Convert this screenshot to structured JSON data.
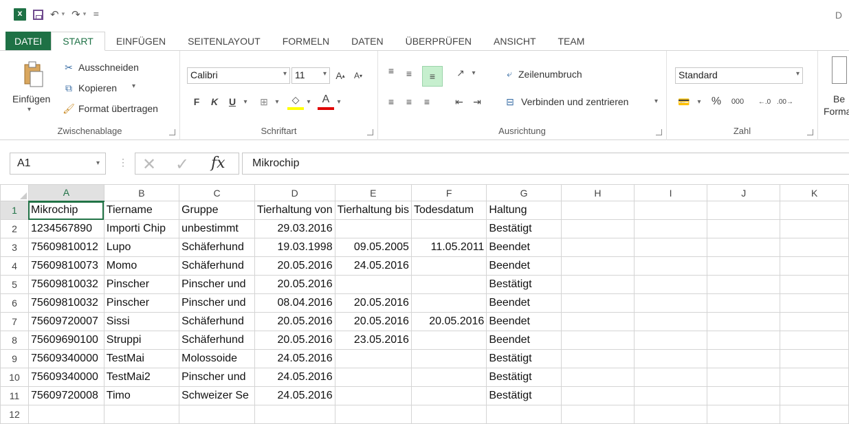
{
  "app": {
    "logo_text": "X",
    "title_partial": "D"
  },
  "tabs": [
    {
      "label": "DATEI"
    },
    {
      "label": "START"
    },
    {
      "label": "EINFÜGEN"
    },
    {
      "label": "SEITENLAYOUT"
    },
    {
      "label": "FORMELN"
    },
    {
      "label": "DATEN"
    },
    {
      "label": "ÜBERPRÜFEN"
    },
    {
      "label": "ANSICHT"
    },
    {
      "label": "TEAM"
    }
  ],
  "ribbon": {
    "clipboard": {
      "paste": "Einfügen",
      "cut": "Ausschneiden",
      "copy": "Kopieren",
      "format_painter": "Format übertragen",
      "label": "Zwischenablage"
    },
    "font": {
      "font_name": "Calibri",
      "font_size": "11",
      "bold": "F",
      "italic": "K",
      "underline": "U",
      "label": "Schriftart"
    },
    "alignment": {
      "wrap": "Zeilenumbruch",
      "merge": "Verbinden und zentrieren",
      "label": "Ausrichtung"
    },
    "number": {
      "format": "Standard",
      "percent": "%",
      "thousands": "000",
      "label": "Zahl"
    },
    "styles": {
      "partial_1": "Be",
      "partial_2": "Forma"
    }
  },
  "formula_bar": {
    "name_box": "A1",
    "fx": "fx",
    "content": "Mikrochip"
  },
  "sheet": {
    "columns": [
      "A",
      "B",
      "C",
      "D",
      "E",
      "F",
      "G",
      "H",
      "I",
      "J",
      "K"
    ],
    "rows": [
      {
        "n": "1",
        "cells": [
          "Mikrochip",
          "Tiername",
          "Gruppe",
          "Tierhaltung von",
          "Tierhaltung bis",
          "Todesdatum",
          "Haltung",
          "",
          "",
          "",
          ""
        ]
      },
      {
        "n": "2",
        "cells": [
          "1234567890",
          "Importi Chip",
          "unbestimmt",
          "29.03.2016",
          "",
          "",
          "Bestätigt",
          "",
          "",
          "",
          ""
        ]
      },
      {
        "n": "3",
        "cells": [
          "75609810012",
          "Lupo",
          "Schäferhund",
          "19.03.1998",
          "09.05.2005",
          "11.05.2011",
          "Beendet",
          "",
          "",
          "",
          ""
        ]
      },
      {
        "n": "4",
        "cells": [
          "75609810073",
          "Momo",
          "Schäferhund",
          "20.05.2016",
          "24.05.2016",
          "",
          "Beendet",
          "",
          "",
          "",
          ""
        ]
      },
      {
        "n": "5",
        "cells": [
          "75609810032",
          "Pinscher",
          "Pinscher und",
          "20.05.2016",
          "",
          "",
          "Bestätigt",
          "",
          "",
          "",
          ""
        ]
      },
      {
        "n": "6",
        "cells": [
          "75609810032",
          "Pinscher",
          "Pinscher und",
          "08.04.2016",
          "20.05.2016",
          "",
          "Beendet",
          "",
          "",
          "",
          ""
        ]
      },
      {
        "n": "7",
        "cells": [
          "75609720007",
          "Sissi",
          "Schäferhund",
          "20.05.2016",
          "20.05.2016",
          "20.05.2016",
          "Beendet",
          "",
          "",
          "",
          ""
        ]
      },
      {
        "n": "8",
        "cells": [
          "75609690100",
          "Struppi",
          "Schäferhund",
          "20.05.2016",
          "23.05.2016",
          "",
          "Beendet",
          "",
          "",
          "",
          ""
        ]
      },
      {
        "n": "9",
        "cells": [
          "75609340000",
          "TestMai",
          "Molossoide",
          "24.05.2016",
          "",
          "",
          "Bestätigt",
          "",
          "",
          "",
          ""
        ]
      },
      {
        "n": "10",
        "cells": [
          "75609340000",
          "TestMai2",
          "Pinscher und",
          "24.05.2016",
          "",
          "",
          "Bestätigt",
          "",
          "",
          "",
          ""
        ]
      },
      {
        "n": "11",
        "cells": [
          "75609720008",
          "Timo",
          "Schweizer Se",
          "24.05.2016",
          "",
          "",
          "Bestätigt",
          "",
          "",
          "",
          ""
        ]
      },
      {
        "n": "12",
        "cells": [
          "",
          "",
          "",
          "",
          "",
          "",
          "",
          "",
          "",
          "",
          ""
        ]
      }
    ]
  }
}
